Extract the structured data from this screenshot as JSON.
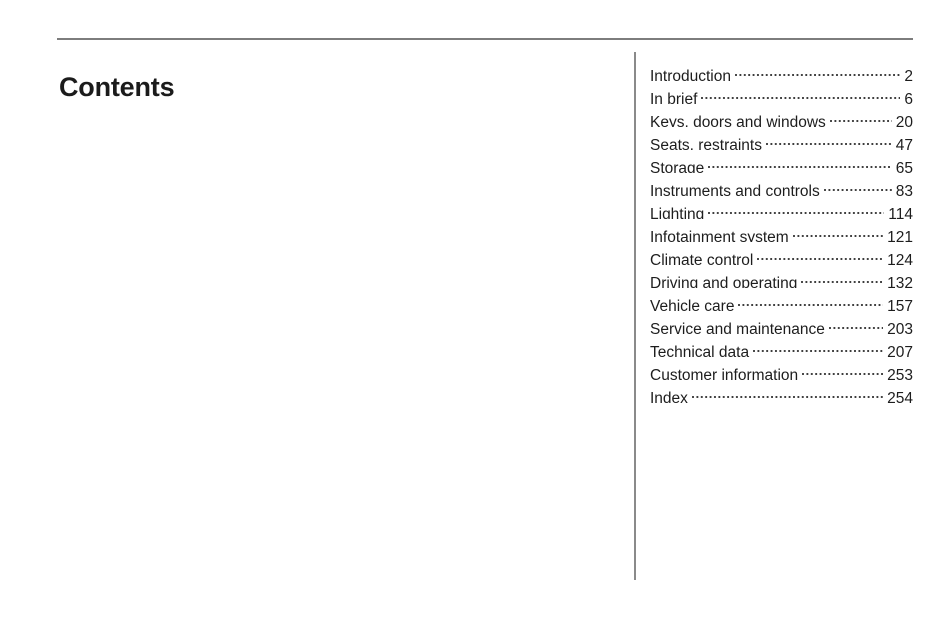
{
  "document": {
    "title": "Contents",
    "background_color": "#ffffff",
    "text_color": "#1d1d1d",
    "rule_color": "#7d7d7d",
    "divider_color": "#8a8a8a"
  },
  "toc": {
    "entries": [
      {
        "title": "Introduction",
        "page": "2"
      },
      {
        "title": "In brief",
        "page": "6"
      },
      {
        "title": "Keys, doors and windows",
        "page": "20"
      },
      {
        "title": "Seats, restraints",
        "page": "47"
      },
      {
        "title": "Storage",
        "page": "65"
      },
      {
        "title": "Instruments and controls",
        "page": "83"
      },
      {
        "title": "Lighting",
        "page": "114"
      },
      {
        "title": "Infotainment system",
        "page": "121"
      },
      {
        "title": "Climate control",
        "page": "124"
      },
      {
        "title": "Driving and operating",
        "page": "132"
      },
      {
        "title": "Vehicle care",
        "page": "157"
      },
      {
        "title": "Service and maintenance",
        "page": "203"
      },
      {
        "title": "Technical data",
        "page": "207"
      },
      {
        "title": "Customer information",
        "page": "253"
      },
      {
        "title": "Index",
        "page": "254"
      }
    ]
  }
}
